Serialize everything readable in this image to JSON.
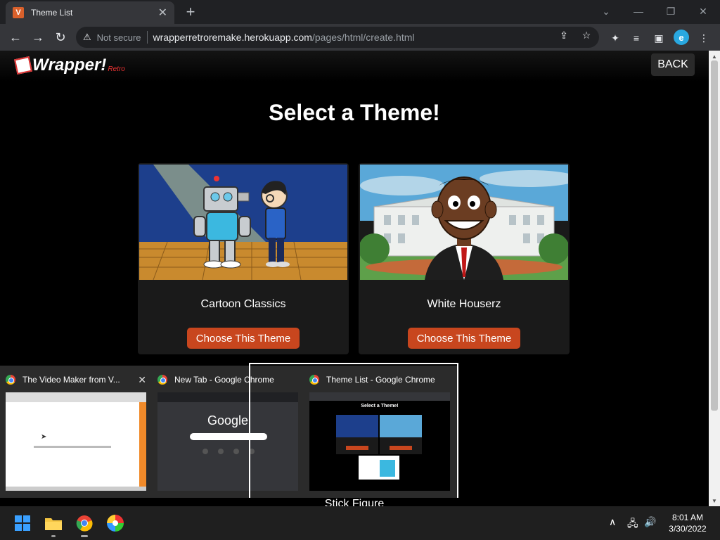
{
  "browser": {
    "tab_title": "Theme List",
    "tab_favicon_letter": "V",
    "security_label": "Not secure",
    "url_host": "wrapperretroremake.herokuapp.com",
    "url_path": "/pages/html/create.html",
    "profile_letter": "e"
  },
  "header": {
    "logo_text": "rapper!",
    "logo_w": "W",
    "logo_sub": "Retro",
    "back_label": "BACK"
  },
  "page": {
    "heading": "Select a Theme!",
    "themes": [
      {
        "name": "Cartoon Classics",
        "button": "Choose This Theme"
      },
      {
        "name": "White Houserz",
        "button": "Choose This Theme"
      }
    ],
    "partial_theme": "Stick Figure"
  },
  "taskbar_popup": {
    "windows": [
      {
        "title": "The Video Maker from V..."
      },
      {
        "title": "New Tab - Google Chrome",
        "preview_brand": "Google"
      },
      {
        "title": "Theme List - Google Chrome",
        "preview_heading": "Select a Theme!"
      }
    ]
  },
  "system": {
    "time": "8:01 AM",
    "date": "3/30/2022"
  },
  "colors": {
    "accent_button": "#c8461e",
    "page_bg": "#000000",
    "chrome_bg": "#35363a"
  }
}
